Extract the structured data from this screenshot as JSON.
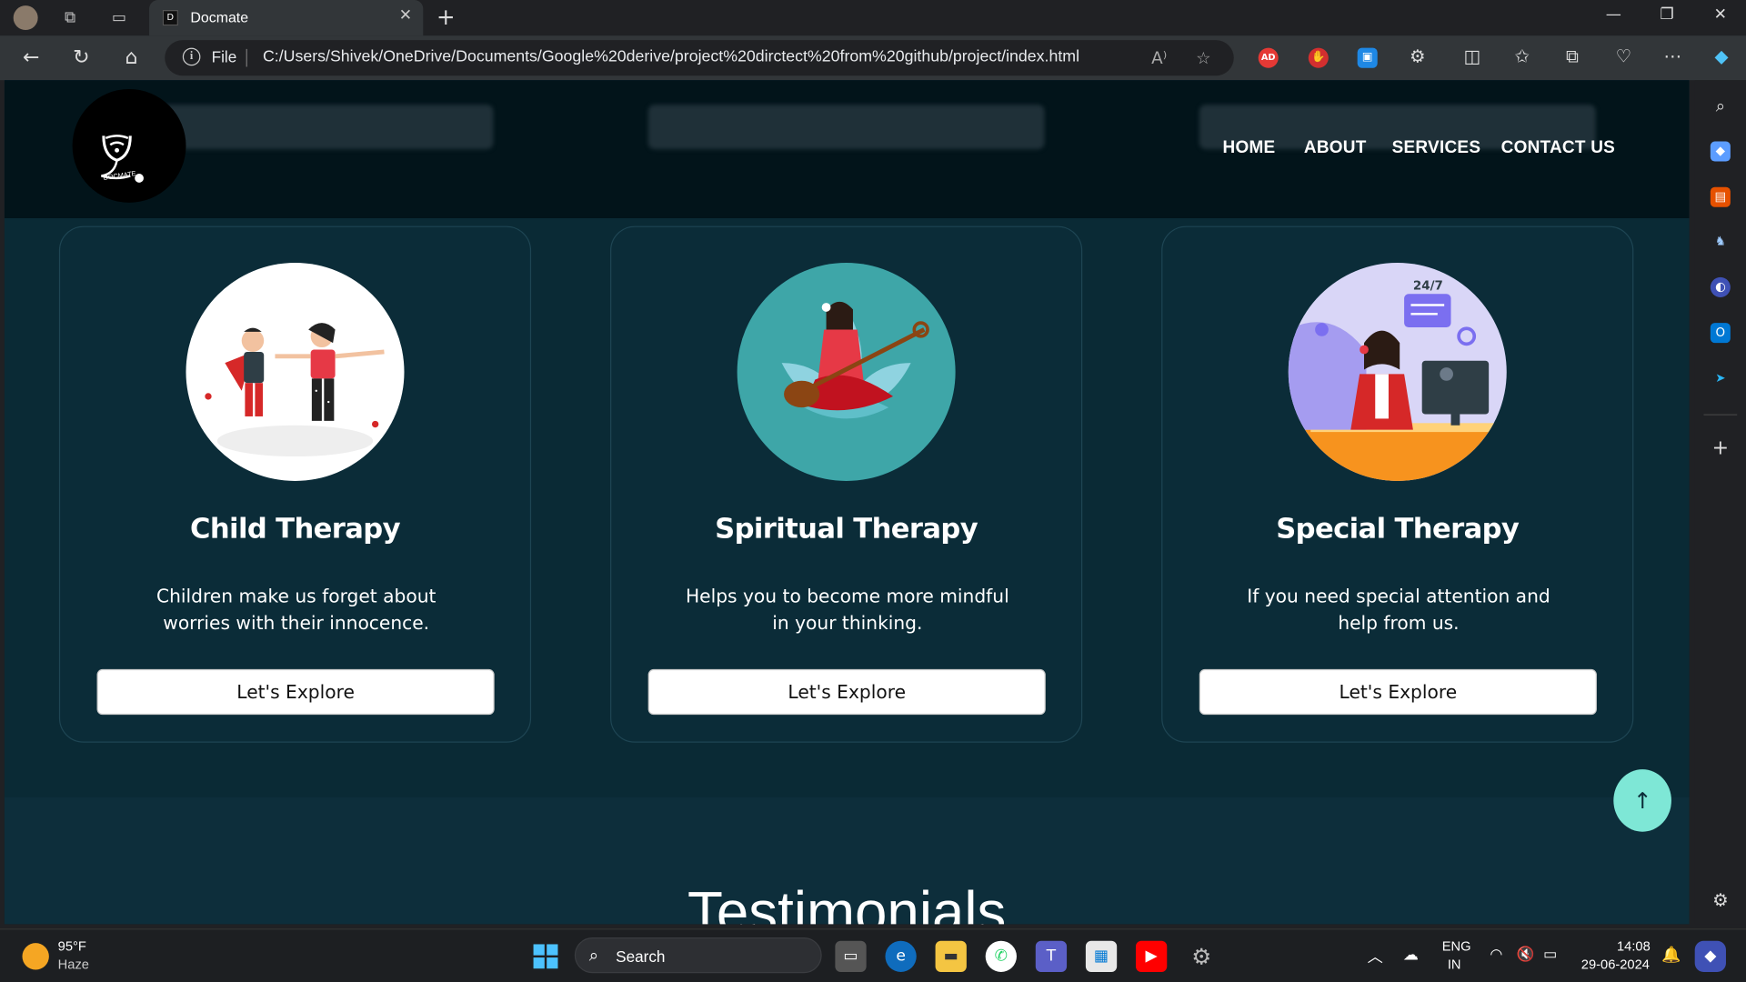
{
  "browser": {
    "tab_title": "Docmate",
    "tab_favicon": "D",
    "file_label": "File",
    "url": "C:/Users/Shivek/OneDrive/Documents/Google%20derive/project%20dirctect%20from%20github/project/index.html",
    "read_aloud": "A⁾",
    "extensions": [
      {
        "name": "adblock-icon",
        "glyph": "AD",
        "color": "#e53935"
      },
      {
        "name": "stop-hand-icon",
        "glyph": "✋",
        "color": "#d32f2f"
      },
      {
        "name": "image-extension-icon",
        "glyph": "▣",
        "color": "#1e88e5"
      }
    ]
  },
  "site": {
    "nav": [
      "HOME",
      "ABOUT",
      "SERVICES",
      "CONTACT US"
    ],
    "logo_text": "DOCMATE",
    "cards": [
      {
        "title": "Child Therapy",
        "desc": "Children make us forget about worries with their innocence.",
        "button": "Let's Explore"
      },
      {
        "title": "Spiritual Therapy",
        "desc": "Helps you to become more mindful in your thinking.",
        "button": "Let's Explore"
      },
      {
        "title": "Special Therapy",
        "desc": "If you need special attention and help from us.",
        "button": "Let's Explore"
      }
    ],
    "special_badge": "24/7",
    "testimonials_title": "Testimonials",
    "back_to_top": "↑"
  },
  "taskbar": {
    "weather_temp": "95°F",
    "weather_desc": "Haze",
    "search_label": "Search",
    "lang_top": "ENG",
    "lang_bottom": "IN",
    "time": "14:08",
    "date": "29-06-2024"
  },
  "colors": {
    "page_bg": "#0a2a35",
    "header_bg": "#02141a",
    "accent_button": "#7ee7d6"
  }
}
